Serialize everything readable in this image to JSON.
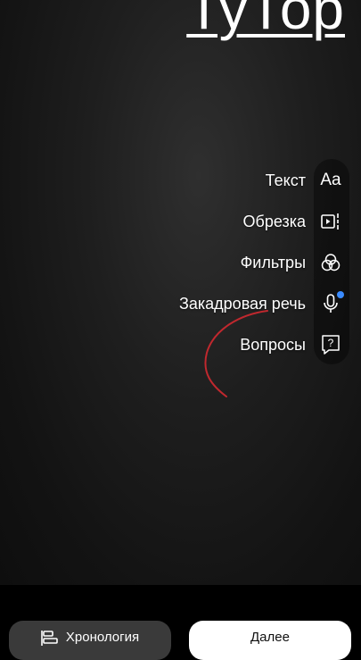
{
  "overlay": {
    "title": "ТуТор"
  },
  "tools": [
    {
      "label": "Текст",
      "icon": "text-aa-icon",
      "glyph": "Aa"
    },
    {
      "label": "Обрезка",
      "icon": "trim-icon"
    },
    {
      "label": "Фильтры",
      "icon": "filters-icon"
    },
    {
      "label": "Закадровая речь",
      "icon": "microphone-icon",
      "badge": "new-dot"
    },
    {
      "label": "Вопросы",
      "icon": "question-icon"
    }
  ],
  "bottom_bar": {
    "timeline_label": "Хронология",
    "next_label": "Далее"
  },
  "colors": {
    "badge": "#3a8bff",
    "annotation_stroke": "#c0282e",
    "next_button_bg": "#ffffff",
    "timeline_button_bg": "#3a3a3a"
  }
}
